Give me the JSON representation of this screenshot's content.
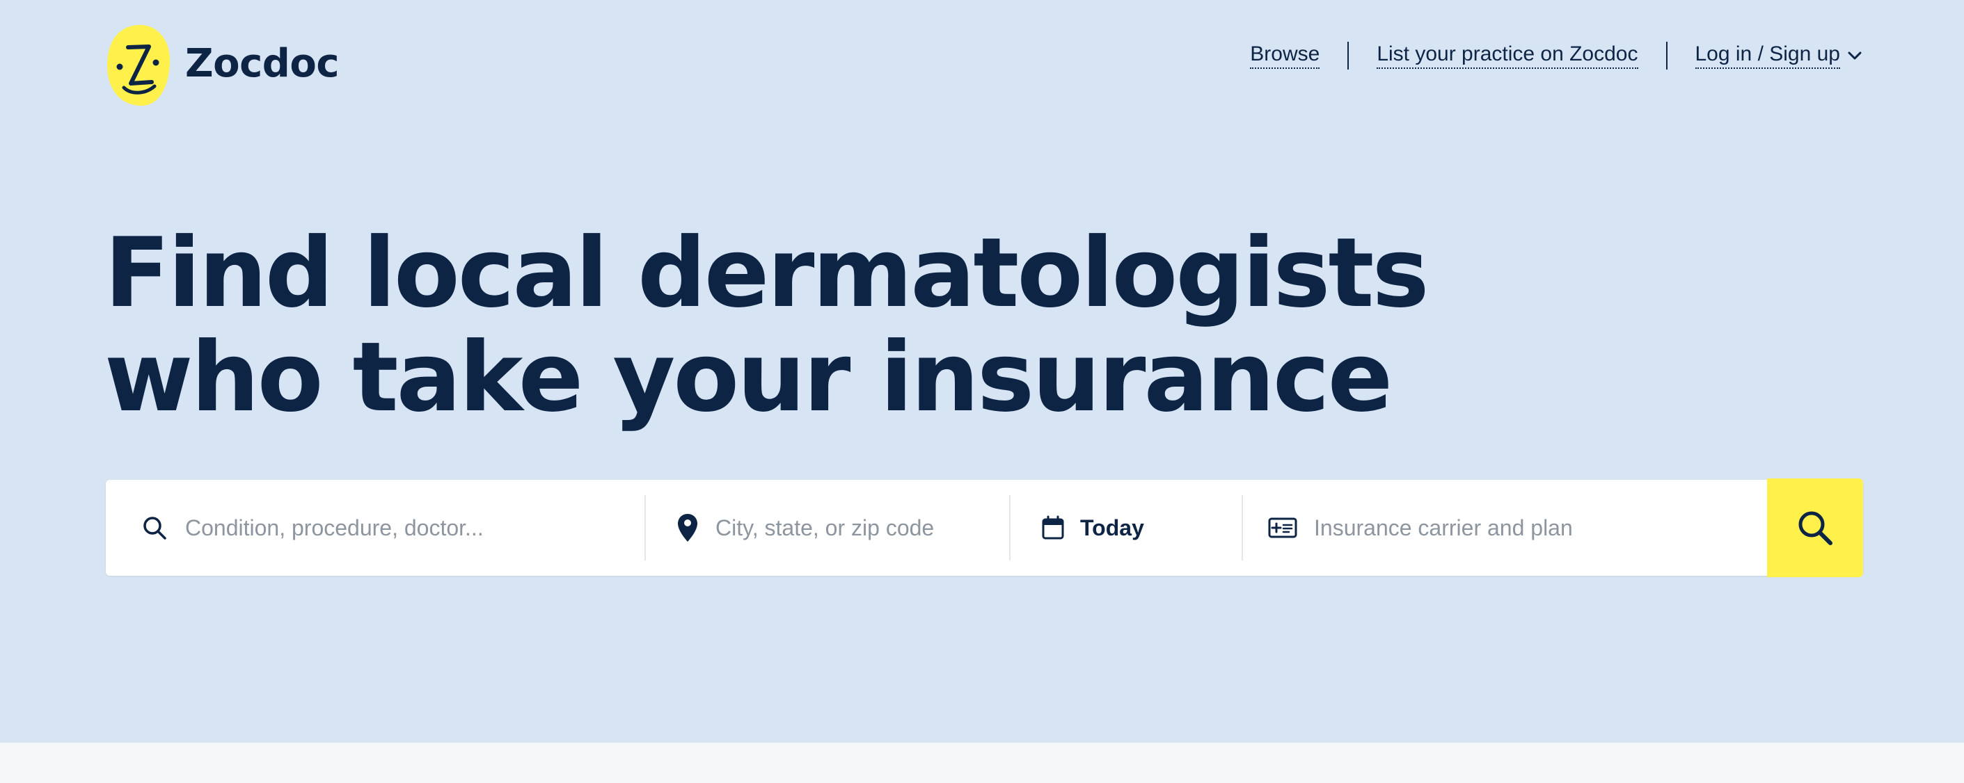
{
  "brand": {
    "name": "Zocdoc",
    "logo_color": "#fff04b",
    "text_color": "#0d2445"
  },
  "nav": {
    "browse": "Browse",
    "list_practice": "List your practice on Zocdoc",
    "login": "Log in / Sign up"
  },
  "hero": {
    "headline_line1": "Find local dermatologists",
    "headline_line2": "who take your insurance",
    "background": "#d6e4f3"
  },
  "search": {
    "condition_placeholder": "Condition, procedure, doctor...",
    "location_placeholder": "City, state, or zip code",
    "date_value": "Today",
    "insurance_placeholder": "Insurance carrier and plan",
    "button_color": "#fff04b",
    "icons": {
      "condition": "search-icon",
      "location": "map-pin-icon",
      "date": "calendar-icon",
      "insurance": "insurance-card-icon",
      "submit": "search-icon"
    }
  }
}
